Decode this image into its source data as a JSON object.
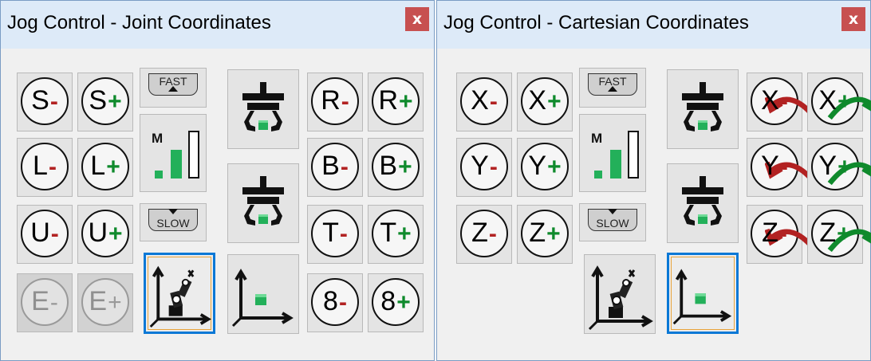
{
  "colors": {
    "minus": "#b22222",
    "plus": "#0f8a2c",
    "cube": "#23b05a",
    "selected_outline": "#0a78d6",
    "close_bg": "#c75050"
  },
  "joint_window": {
    "title": "Jog Control - Joint Coordinates",
    "close_label": "x",
    "rows": [
      {
        "minus_axis": "S",
        "plus_axis": "S"
      },
      {
        "minus_axis": "L",
        "plus_axis": "L"
      },
      {
        "minus_axis": "U",
        "plus_axis": "U"
      },
      {
        "minus_axis": "E",
        "plus_axis": "E"
      }
    ],
    "right_rows": [
      {
        "minus_axis": "R",
        "plus_axis": "R"
      },
      {
        "minus_axis": "B",
        "plus_axis": "B"
      },
      {
        "minus_axis": "T",
        "plus_axis": "T"
      },
      {
        "minus_axis": "8",
        "plus_axis": "8"
      }
    ],
    "disabled_axes": [
      "E"
    ],
    "speed_up_label": "FAST",
    "speed_down_label": "SLOW",
    "speed_level_label": "M",
    "speed_level": "2 of 3",
    "selected_frame": "robot",
    "icons": [
      "gripper-icon",
      "gripper-icon",
      "robot-frame-icon",
      "cube-frame-icon"
    ]
  },
  "cartesian_window": {
    "title": "Jog Control - Cartesian Coordinates",
    "close_label": "x",
    "rows": [
      {
        "minus_axis": "X",
        "plus_axis": "X"
      },
      {
        "minus_axis": "Y",
        "plus_axis": "Y"
      },
      {
        "minus_axis": "Z",
        "plus_axis": "Z"
      }
    ],
    "rotation_rows": [
      {
        "minus_axis": "X",
        "plus_axis": "X"
      },
      {
        "minus_axis": "Y",
        "plus_axis": "Y"
      },
      {
        "minus_axis": "Z",
        "plus_axis": "Z"
      }
    ],
    "speed_up_label": "FAST",
    "speed_down_label": "SLOW",
    "speed_level_label": "M",
    "speed_level": "2 of 3",
    "selected_frame": "cube",
    "icons": [
      "gripper-icon",
      "gripper-icon",
      "robot-frame-icon",
      "cube-frame-icon"
    ]
  }
}
